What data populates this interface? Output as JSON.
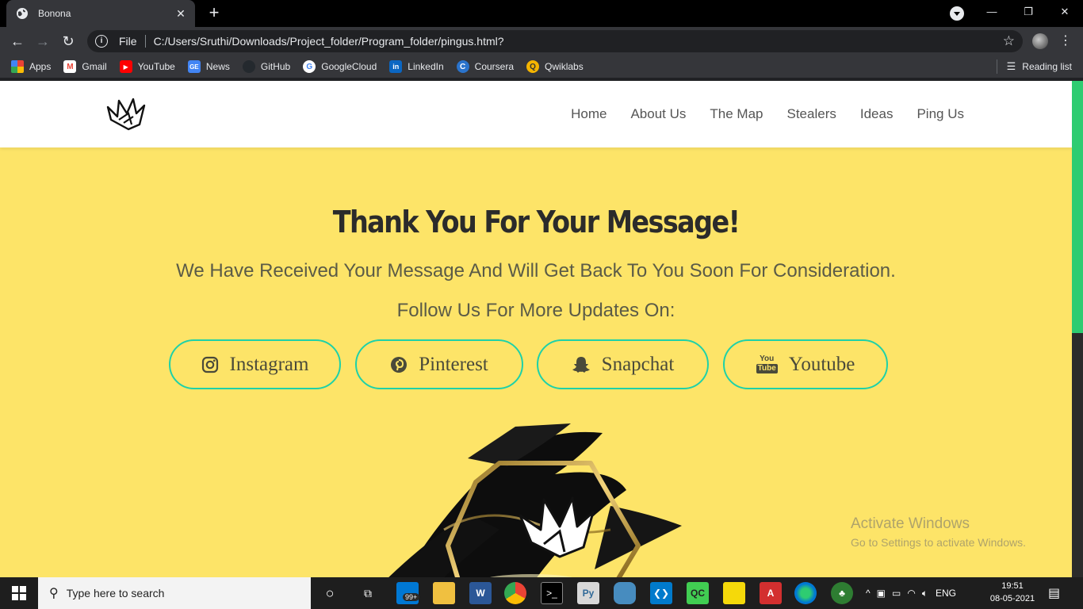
{
  "browser": {
    "tab_title": "Bonona",
    "scheme_label": "File",
    "url": "C:/Users/Sruthi/Downloads/Project_folder/Program_folder/pingus.html?",
    "bookmarks": [
      "Apps",
      "Gmail",
      "YouTube",
      "News",
      "GitHub",
      "GoogleCloud",
      "LinkedIn",
      "Coursera",
      "Qwiklabs"
    ],
    "reading_list": "Reading list"
  },
  "site": {
    "nav": [
      "Home",
      "About Us",
      "The Map",
      "Stealers",
      "Ideas",
      "Ping Us"
    ],
    "heading": "Thank You For Your Message!",
    "subtext": "We Have Received Your Message And Will Get Back To You Soon For Consideration.",
    "follow": "Follow Us For More Updates On:",
    "social": {
      "instagram": "Instagram",
      "pinterest": "Pinterest",
      "snapchat": "Snapchat",
      "youtube": "Youtube",
      "youtube_icon_top": "You",
      "youtube_icon_bottom": "Tube"
    },
    "colors": {
      "page_bg": "#fde468",
      "button_border": "#1ed1a8",
      "scroll_thumb": "#2ecc71"
    }
  },
  "watermark": {
    "line1": "Activate Windows",
    "line2": "Go to Settings to activate Windows."
  },
  "taskbar": {
    "search_placeholder": "Type here to search",
    "mail_badge": "99+",
    "language": "ENG",
    "time": "19:51",
    "date": "08-05-2021"
  }
}
